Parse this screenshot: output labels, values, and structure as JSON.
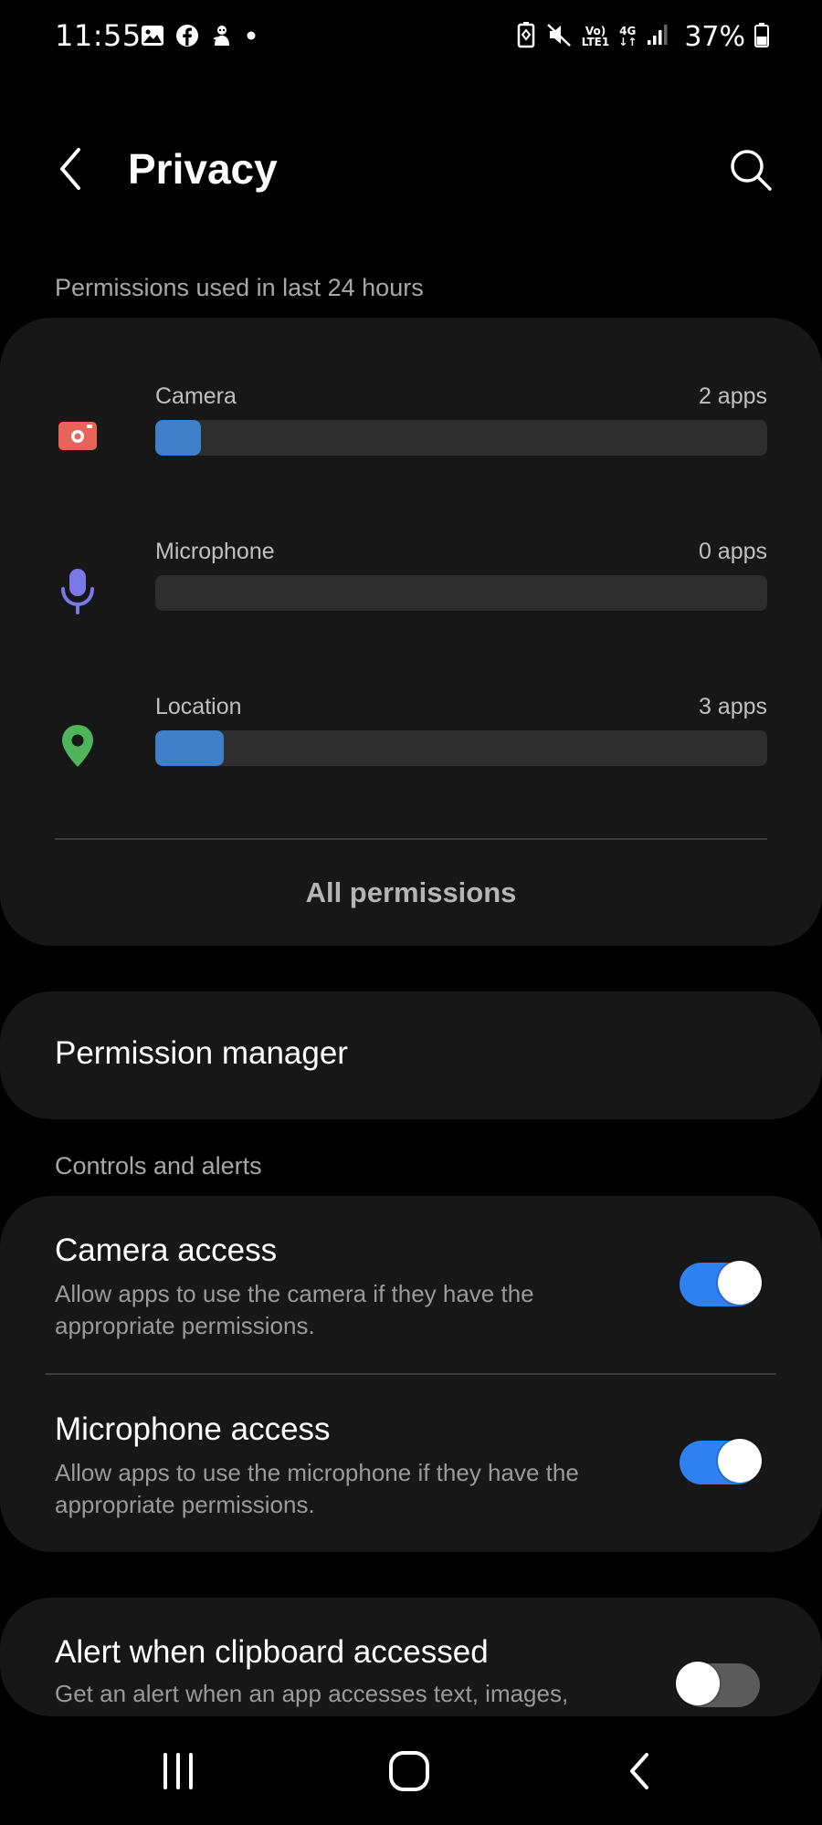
{
  "status_bar": {
    "time": "11:55",
    "network_volte": "Vo)",
    "network_lte": "LTE1",
    "network_type": "4G",
    "battery_percent": "37%"
  },
  "header": {
    "title": "Privacy",
    "back_icon": "chevron-left-icon",
    "search_icon": "search-icon"
  },
  "usage": {
    "section_label": "Permissions used in last 24 hours",
    "items": [
      {
        "name": "Camera",
        "count": "2 apps",
        "icon": "camera-icon",
        "icon_color": "#e8645a",
        "fill_fraction": 0.075
      },
      {
        "name": "Microphone",
        "count": "0 apps",
        "icon": "microphone-icon",
        "icon_color": "#7b78e8",
        "fill_fraction": 0
      },
      {
        "name": "Location",
        "count": "3 apps",
        "icon": "location-pin-icon",
        "icon_color": "#4fb55b",
        "fill_fraction": 0.112
      }
    ],
    "all_permissions_label": "All permissions"
  },
  "permission_manager": {
    "label": "Permission manager"
  },
  "controls": {
    "section_label": "Controls and alerts",
    "items": [
      {
        "title": "Camera access",
        "description": "Allow apps to use the camera if they have the appropriate permissions.",
        "enabled": true
      },
      {
        "title": "Microphone access",
        "description": "Allow apps to use the microphone if they have the appropriate permissions.",
        "enabled": true
      }
    ]
  },
  "clipboard_alert": {
    "title": "Alert when clipboard accessed",
    "description": "Get an alert when an app accesses text, images,",
    "enabled": false
  },
  "colors": {
    "accent": "#2f80f0",
    "bar_fill": "#3f7ec9",
    "card_bg": "#171717",
    "background": "#000000"
  },
  "nav_bar": {
    "recents_icon": "recents-icon",
    "home_icon": "home-icon",
    "back_icon": "back-icon"
  }
}
